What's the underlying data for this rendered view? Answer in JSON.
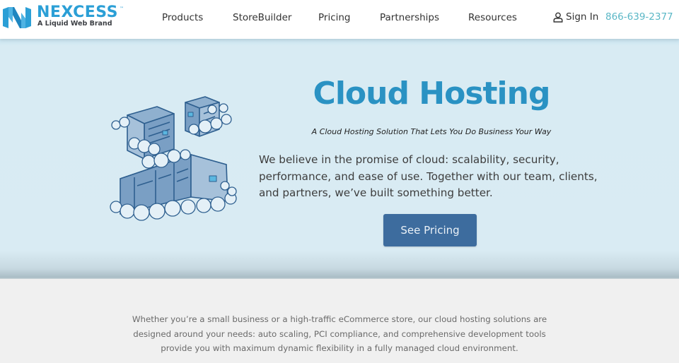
{
  "header": {
    "logo": {
      "name": "nexcess",
      "tagline": "A Liquid Web Brand",
      "trademark": "™",
      "brand_color": "#2b9fd6"
    },
    "nav": [
      {
        "label": "Products"
      },
      {
        "label": "StoreBuilder"
      },
      {
        "label": "Pricing"
      },
      {
        "label": "Partnerships"
      },
      {
        "label": "Resources"
      }
    ],
    "sign_in": {
      "label": "Sign In",
      "icon": "user-icon"
    },
    "phone": {
      "label": "866-639-2377",
      "color": "#5ab7c6"
    }
  },
  "hero": {
    "illustration": "cloud-servers-illustration",
    "title": "Cloud Hosting",
    "title_color": "#2a92c3",
    "subtitle": "A Cloud Hosting Solution That Lets You Do Business Your Way",
    "body_lines": [
      "We believe in the promise of cloud: scalability, security,",
      "performance, and ease of use. Together with our team, clients,",
      "and partners, we’ve built something better."
    ],
    "cta": {
      "label": "See Pricing",
      "color": "#3d6c9e"
    }
  },
  "intro": {
    "lines": [
      "Whether you’re a small business or a high-traffic eCommerce store, our cloud hosting solutions are",
      "designed around your needs: auto scaling, PCI compliance, and comprehensive development tools",
      "provide you with maximum dynamic flexibility in a fully managed cloud environment."
    ]
  }
}
